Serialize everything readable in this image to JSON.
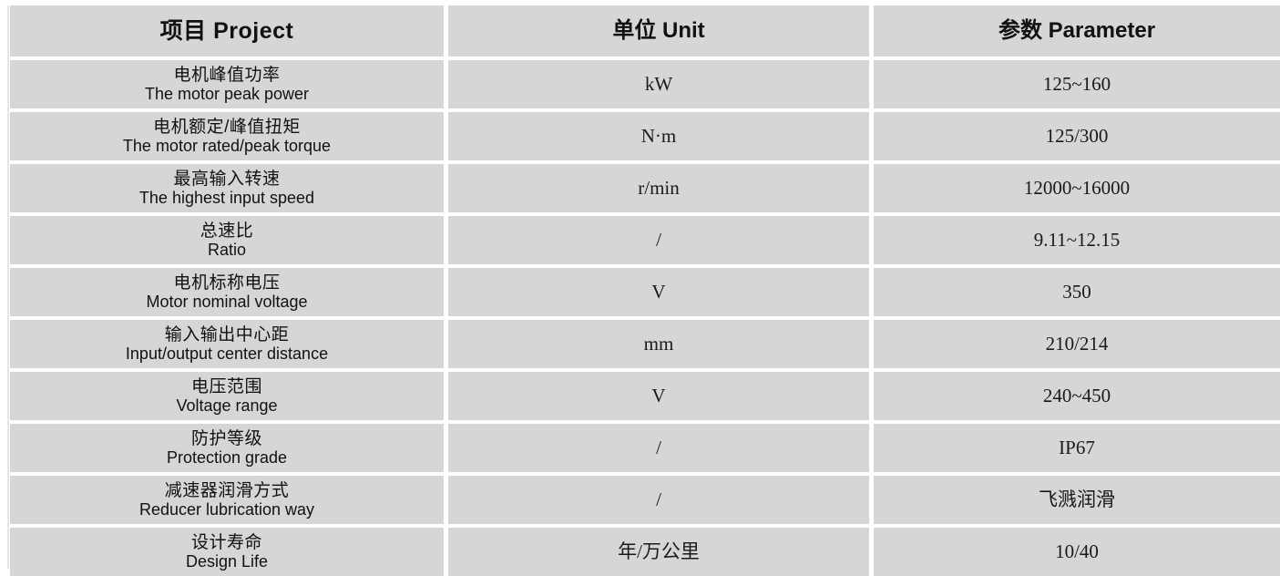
{
  "table": {
    "headers": [
      {
        "cn": "项目",
        "en": "Project",
        "combined": "项目  Project"
      },
      {
        "cn": "单位",
        "en": "Unit",
        "combined": "单位 Unit"
      },
      {
        "cn": "参数",
        "en": "Parameter",
        "combined": "参数 Parameter"
      }
    ],
    "rows": [
      {
        "project_cn": "电机峰值功率",
        "project_en": "The motor peak power",
        "unit": "kW",
        "parameter": "125~160"
      },
      {
        "project_cn": "电机额定/峰值扭矩",
        "project_en": "The motor rated/peak torque",
        "unit": "N·m",
        "parameter": "125/300"
      },
      {
        "project_cn": "最高输入转速",
        "project_en": "The highest input speed",
        "unit": "r/min",
        "parameter": "12000~16000"
      },
      {
        "project_cn": "总速比",
        "project_en": "Ratio",
        "unit": "/",
        "parameter": "9.11~12.15"
      },
      {
        "project_cn": "电机标称电压",
        "project_en": "Motor nominal voltage",
        "unit": "V",
        "parameter": "350"
      },
      {
        "project_cn": "输入输出中心距",
        "project_en": "Input/output center distance",
        "unit": "mm",
        "parameter": "210/214"
      },
      {
        "project_cn": "电压范围",
        "project_en": "Voltage range",
        "unit": "V",
        "parameter": "240~450"
      },
      {
        "project_cn": "防护等级",
        "project_en": "Protection grade",
        "unit": "/",
        "parameter": "IP67"
      },
      {
        "project_cn": "减速器润滑方式",
        "project_en": "Reducer lubrication way",
        "unit": "/",
        "parameter": "飞溅润滑"
      },
      {
        "project_cn": "设计寿命",
        "project_en": "Design Life",
        "unit": "年/万公里",
        "parameter": "10/40"
      }
    ],
    "colors": {
      "cell_background": "#d6d6d6",
      "page_background": "#ffffff",
      "text": "#111111",
      "rule": "#e6e6e6"
    }
  }
}
